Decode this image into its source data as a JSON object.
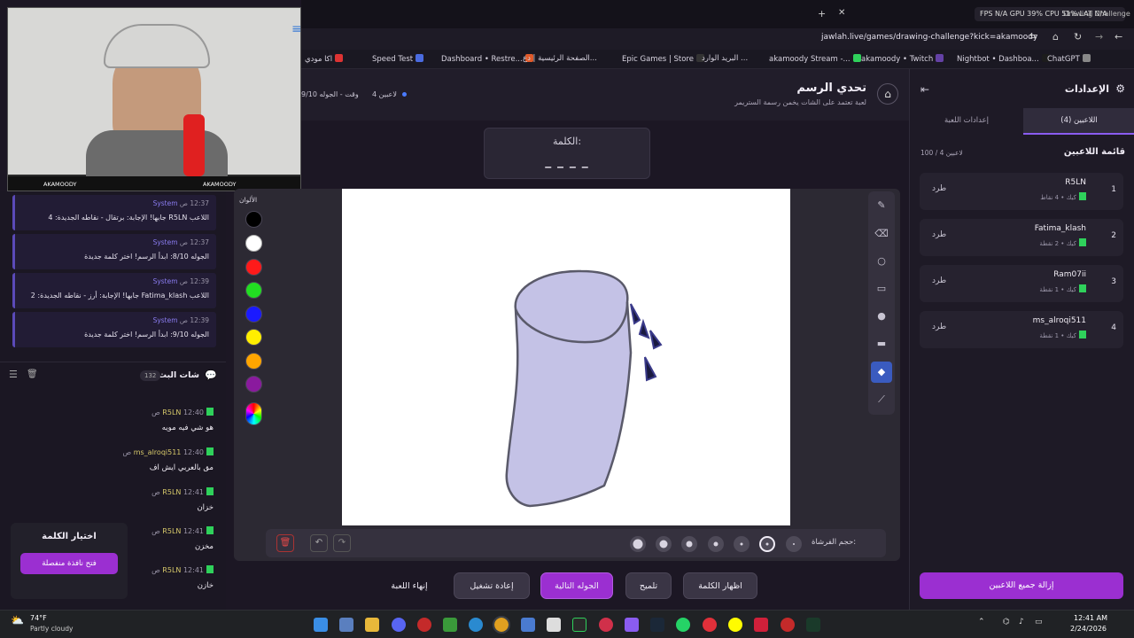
{
  "browser": {
    "tab_title": "Drawing Challenge",
    "perf": "FPS N/A   GPU 39%   CPU 51%   LAT N/A",
    "url": "jawlah.live/games/drawing-challenge?kick=akamoody",
    "bookmarks": [
      "اكا مودي",
      "Speed Test",
      "Dashboard • Restre...",
      "الصفحة الرئيسية | دع...",
      "Epic Games | Store",
      "البريد الوارد ...",
      "akamoody Stream -...",
      "akamoody • Twitch",
      "Nightbot • Dashboa...",
      "ChatGPT"
    ]
  },
  "overlay": {
    "youtube": "AKAMOODY",
    "instagram": "AKAMOODY"
  },
  "system_messages": [
    {
      "time": "12:37 ص",
      "sender": "System",
      "text": "اللاعب R5LN جابها! الإجابة: برتقال - نقاطه الجديدة: 4"
    },
    {
      "time": "12:37 ص",
      "sender": "System",
      "text": "الجوله 8/10: ابدأ الرسم! اختر كلمة جديدة"
    },
    {
      "time": "12:39 ص",
      "sender": "System",
      "text": "اللاعب Fatima_klash جابها! الإجابة: أرز - نقاطه الجديدة: 2"
    },
    {
      "time": "12:39 ص",
      "sender": "System",
      "text": "الجوله 9/10: ابدأ الرسم! اختر كلمة جديدة"
    }
  ],
  "chat": {
    "title": "شات البث",
    "count": "132",
    "messages": [
      {
        "user": "R5LN",
        "time": "12:40 ص",
        "text": "هو شي فيه مويه"
      },
      {
        "user": "ms_alroqi511",
        "time": "12:40 ص",
        "text": "مق بالعربي ايش اف"
      },
      {
        "user": "R5LN",
        "time": "12:41 ص",
        "text": "خزان"
      },
      {
        "user": "R5LN",
        "time": "12:41 ص",
        "text": "مخزن"
      },
      {
        "user": "R5LN",
        "time": "12:41 ص",
        "text": "خازن"
      }
    ]
  },
  "pick_word": {
    "title": "اختيار الكلمة",
    "button": "فتح نافذة منفصلة"
  },
  "game": {
    "title": "تحدي الرسم",
    "subtitle": "لعبة تعتمد على الشات يخمن رسمة الستريمر",
    "players_count": "4 لاعبين",
    "round": "الجوله 9/10",
    "time_label": "وقت",
    "word_label": "الكلمة:",
    "word_mask": "_ _ _ _",
    "colors_label": "الألوان",
    "brush_size_label": "حجم الفرشاة:"
  },
  "colors": [
    "#000000",
    "#ffffff",
    "#ff1a1a",
    "#22dd22",
    "#1a1aff",
    "#ffee00",
    "#ffa500",
    "#8a1a9e"
  ],
  "actions": {
    "show_word": "اظهار الكلمة",
    "hint": "تلميح",
    "next_round": "الجوله التالية",
    "restart": "إعادة تشغيل",
    "end_game": "إنهاء اللعبة"
  },
  "settings": {
    "title": "الإعدادات",
    "tab_players": "اللاعبين (4)",
    "tab_game": "إعدادات اللعبة",
    "list_title": "قائمة اللاعبين",
    "capacity": "100 / 4 لاعبين",
    "kick_label": "طرد",
    "remove_all": "إزالة جميع اللاعبين"
  },
  "players": [
    {
      "rank": "1",
      "name": "R5LN",
      "platform": "كيك",
      "points": "4 نقاط"
    },
    {
      "rank": "2",
      "name": "Fatima_klash",
      "platform": "كيك",
      "points": "2 نقطة"
    },
    {
      "rank": "3",
      "name": "Ram07ii",
      "platform": "كيك",
      "points": "1 نقطة"
    },
    {
      "rank": "4",
      "name": "ms_alroqi511",
      "platform": "كيك",
      "points": "1 نقطة"
    }
  ],
  "taskbar": {
    "weather_temp": "74°F",
    "weather_desc": "Partly cloudy",
    "time": "12:41 AM",
    "date": "2/24/2026"
  },
  "accent_colors": {
    "primary": "#9b2fd1",
    "system": "#5b4ab8",
    "twitch": "#2fd15b"
  }
}
